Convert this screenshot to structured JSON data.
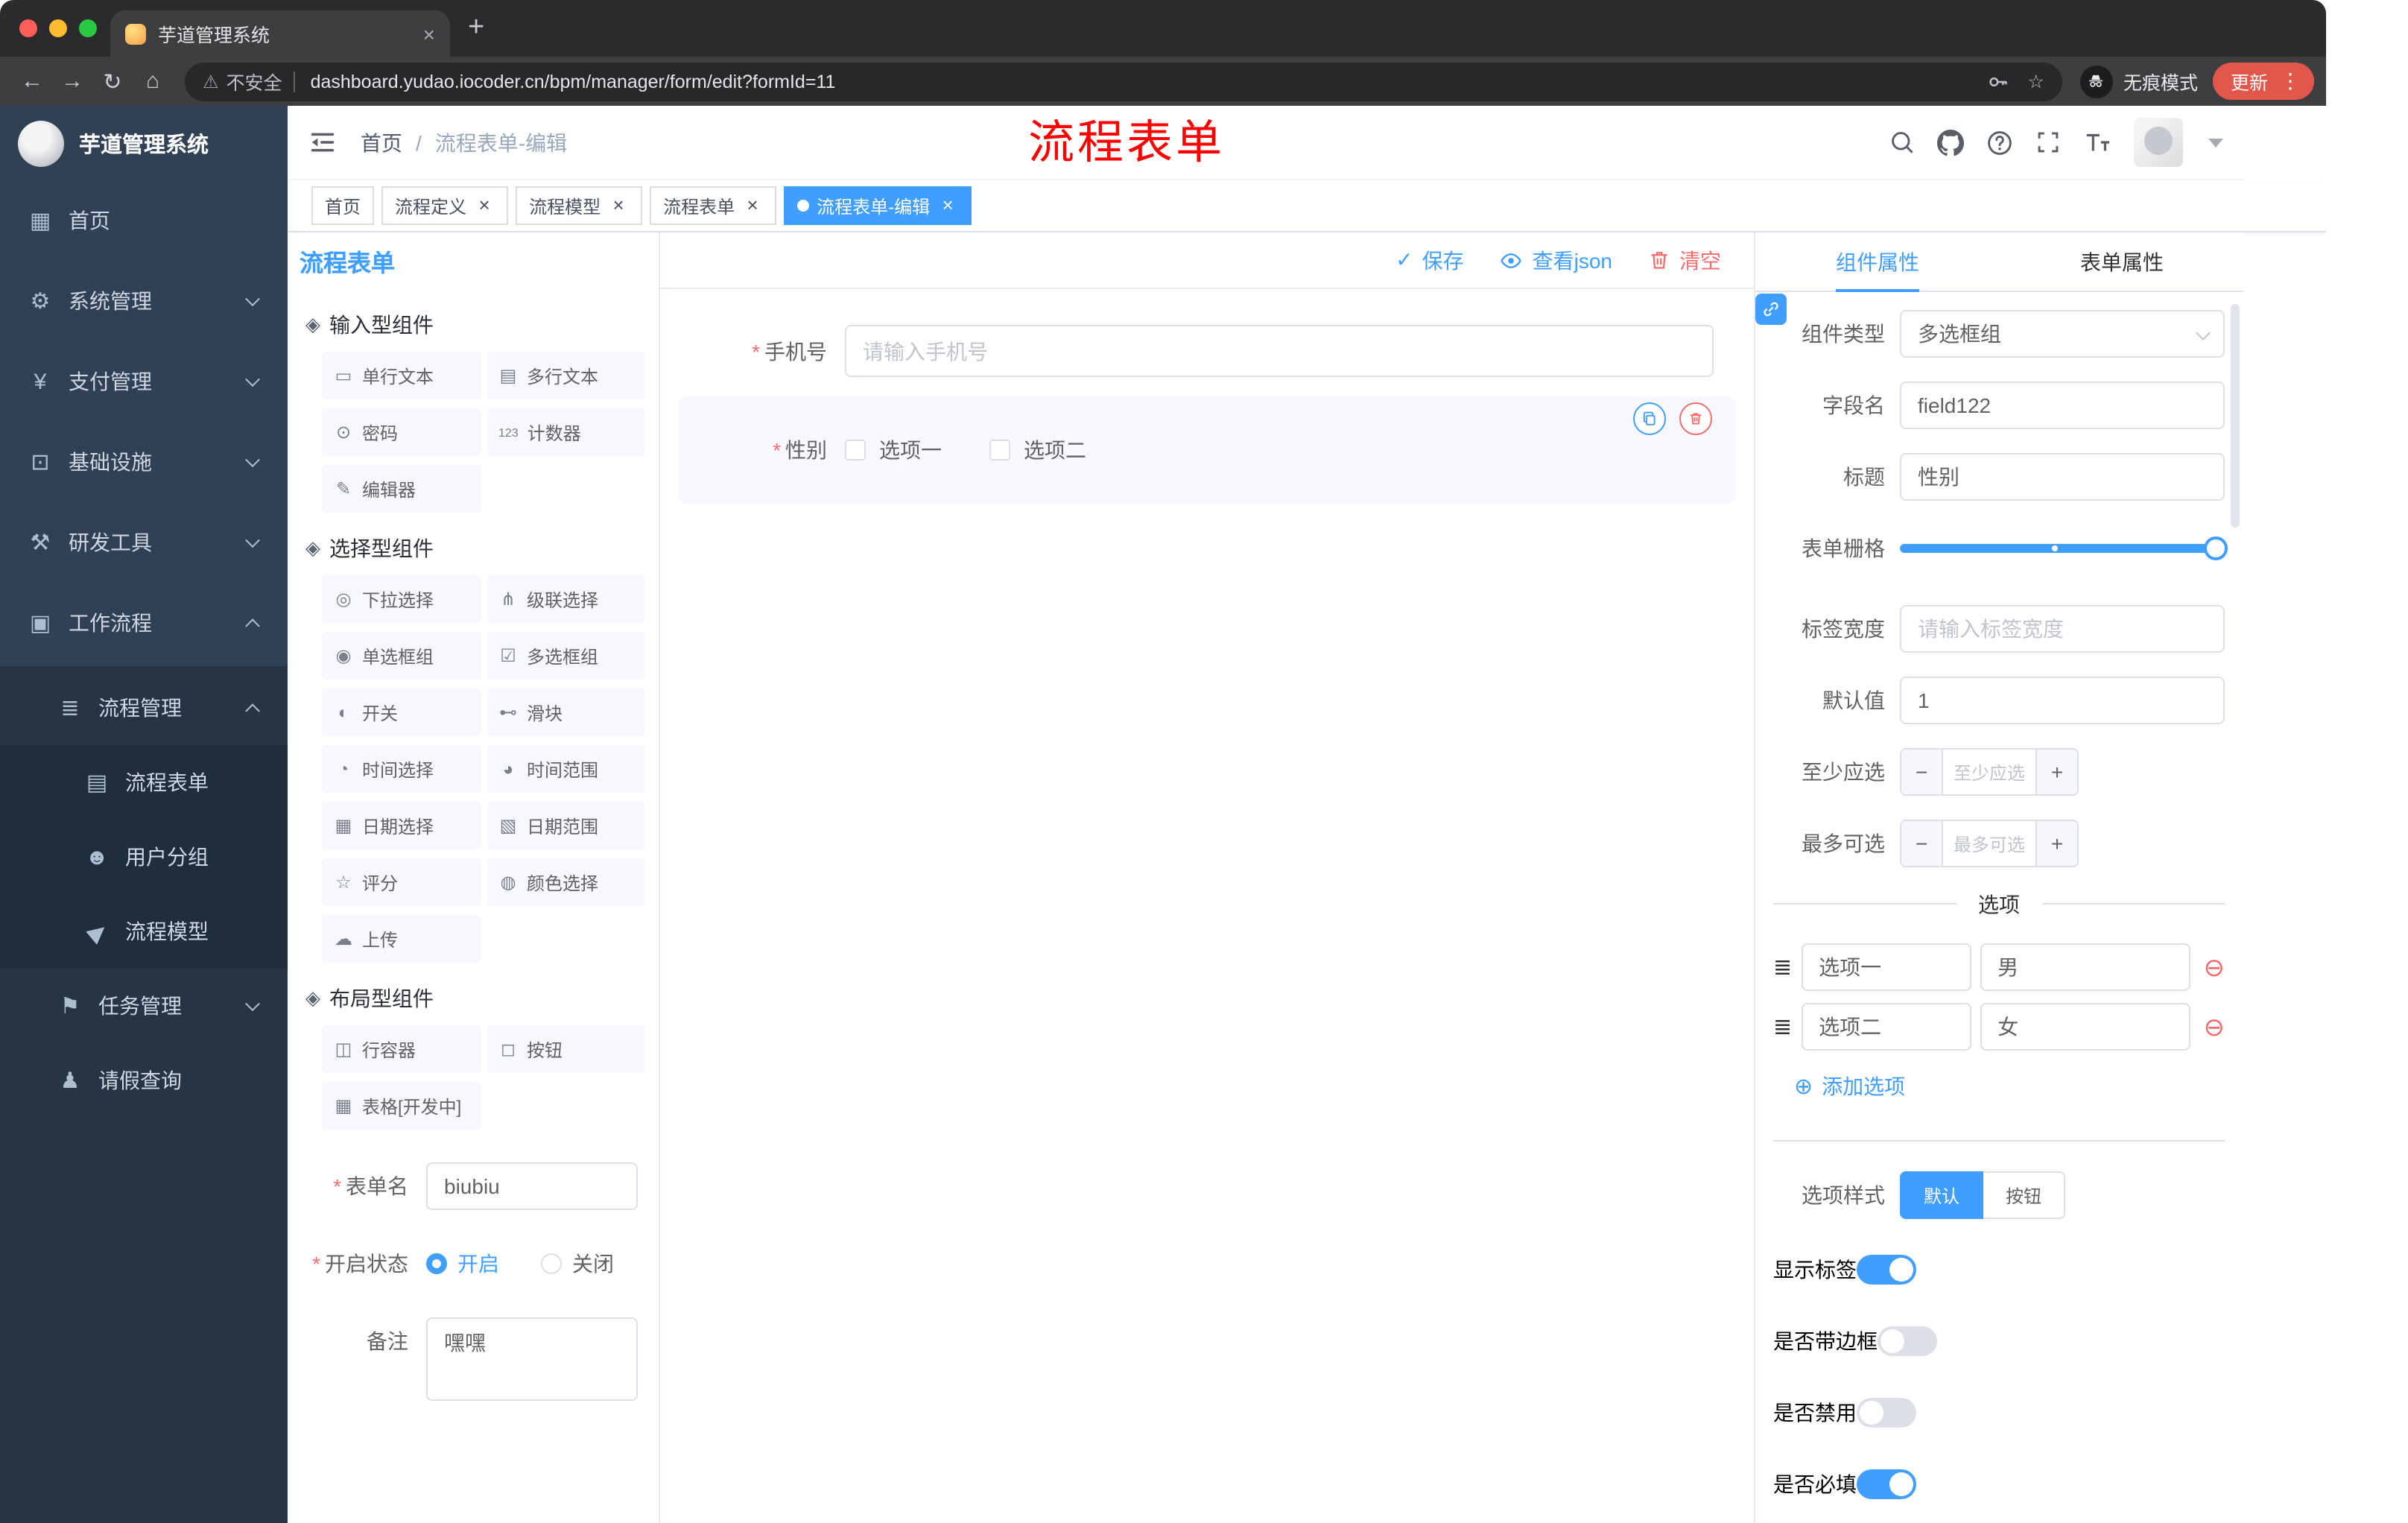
{
  "glyphs": {
    "close": "×",
    "plus": "+",
    "minus": "−",
    "required": "*",
    "back": "←",
    "forward": "→",
    "reload": "↻",
    "home": "⌂",
    "warning": "⚠",
    "star": "☆",
    "dots": "⋮",
    "breadcrumb_sep": "/",
    "check": "✓",
    "add_circle": "⊕",
    "remove_circle": "⊖",
    "drag": "≣"
  },
  "browser": {
    "tab_title": "芋道管理系统",
    "security": "不安全",
    "url": "dashboard.yudao.iocoder.cn/bpm/manager/form/edit?formId=11",
    "incognito": "无痕模式",
    "update": "更新"
  },
  "sidebar": {
    "logo": "芋道管理系统",
    "menu": [
      {
        "label": "首页",
        "glyph": "▦"
      },
      {
        "label": "系统管理",
        "glyph": "⚙"
      },
      {
        "label": "支付管理",
        "glyph": "¥"
      },
      {
        "label": "基础设施",
        "glyph": "⊡"
      },
      {
        "label": "研发工具",
        "glyph": "⚒"
      },
      {
        "label": "工作流程",
        "glyph": "▣"
      },
      {
        "label": "流程管理",
        "glyph": "≣"
      },
      {
        "label": "流程表单",
        "glyph": "▤"
      },
      {
        "label": "用户分组",
        "glyph": "☻"
      },
      {
        "label": "流程模型",
        "glyph": "▶"
      },
      {
        "label": "任务管理",
        "glyph": "⚑"
      },
      {
        "label": "请假查询",
        "glyph": "♟"
      }
    ]
  },
  "header": {
    "breadcrumb_home": "首页",
    "breadcrumb_current": "流程表单-编辑",
    "annotation": "流程表单"
  },
  "tags": [
    {
      "label": "首页"
    },
    {
      "label": "流程定义"
    },
    {
      "label": "流程模型"
    },
    {
      "label": "流程表单"
    },
    {
      "label": "流程表单-编辑"
    }
  ],
  "designer": {
    "panel_title": "流程表单",
    "save": "保存",
    "view_json": "查看json",
    "clear": "清空",
    "groups": [
      {
        "title": "输入型组件",
        "items": [
          {
            "label": "单行文本",
            "glyph": "▭"
          },
          {
            "label": "多行文本",
            "glyph": "▤"
          },
          {
            "label": "密码",
            "glyph": "⊙"
          },
          {
            "label": "计数器",
            "glyph": "123"
          },
          {
            "label": "编辑器",
            "glyph": "✎"
          }
        ]
      },
      {
        "title": "选择型组件",
        "items": [
          {
            "label": "下拉选择",
            "glyph": "◎"
          },
          {
            "label": "级联选择",
            "glyph": "⋔"
          },
          {
            "label": "单选框组",
            "glyph": "◉"
          },
          {
            "label": "多选框组",
            "glyph": "☑"
          },
          {
            "label": "开关",
            "glyph": "◐"
          },
          {
            "label": "滑块",
            "glyph": "⊷"
          },
          {
            "label": "时间选择",
            "glyph": "◔"
          },
          {
            "label": "时间范围",
            "glyph": "◕"
          },
          {
            "label": "日期选择",
            "glyph": "▦"
          },
          {
            "label": "日期范围",
            "glyph": "▧"
          },
          {
            "label": "评分",
            "glyph": "☆"
          },
          {
            "label": "颜色选择",
            "glyph": "◍"
          },
          {
            "label": "上传",
            "glyph": "☁"
          }
        ]
      },
      {
        "title": "布局型组件",
        "items": [
          {
            "label": "行容器",
            "glyph": "◫"
          },
          {
            "label": "按钮",
            "glyph": "◻"
          },
          {
            "label": "表格[开发中]",
            "glyph": "▦"
          }
        ]
      }
    ],
    "meta": {
      "name_label": "表单名",
      "name_value": "biubiu",
      "status_label": "开启状态",
      "status_on": "开启",
      "status_off": "关闭",
      "remark_label": "备注",
      "remark_value": "嘿嘿"
    },
    "canvas": {
      "phone_label": "手机号",
      "phone_placeholder": "请输入手机号",
      "gender_label": "性别",
      "gender_opt1": "选项一",
      "gender_opt2": "选项二"
    }
  },
  "properties": {
    "tab_component": "组件属性",
    "tab_form": "表单属性",
    "rows": {
      "type_label": "组件类型",
      "type_value": "多选框组",
      "field_label": "字段名",
      "field_value": "field122",
      "title_label": "标题",
      "title_value": "性别",
      "grid_label": "表单栅格",
      "labelw_label": "标签宽度",
      "labelw_placeholder": "请输入标签宽度",
      "default_label": "默认值",
      "default_value": "1",
      "min_label": "至少应选",
      "min_placeholder": "至少应选",
      "max_label": "最多可选",
      "max_placeholder": "最多可选"
    },
    "options": {
      "divider": "选项",
      "rows": [
        {
          "label": "选项一",
          "value": "男"
        },
        {
          "label": "选项二",
          "value": "女"
        }
      ],
      "add": "添加选项"
    },
    "style": {
      "label": "选项样式",
      "opt_default": "默认",
      "opt_button": "按钮"
    },
    "toggles": [
      {
        "label": "显示标签"
      },
      {
        "label": "是否带边框"
      },
      {
        "label": "是否禁用"
      },
      {
        "label": "是否必填"
      }
    ]
  }
}
